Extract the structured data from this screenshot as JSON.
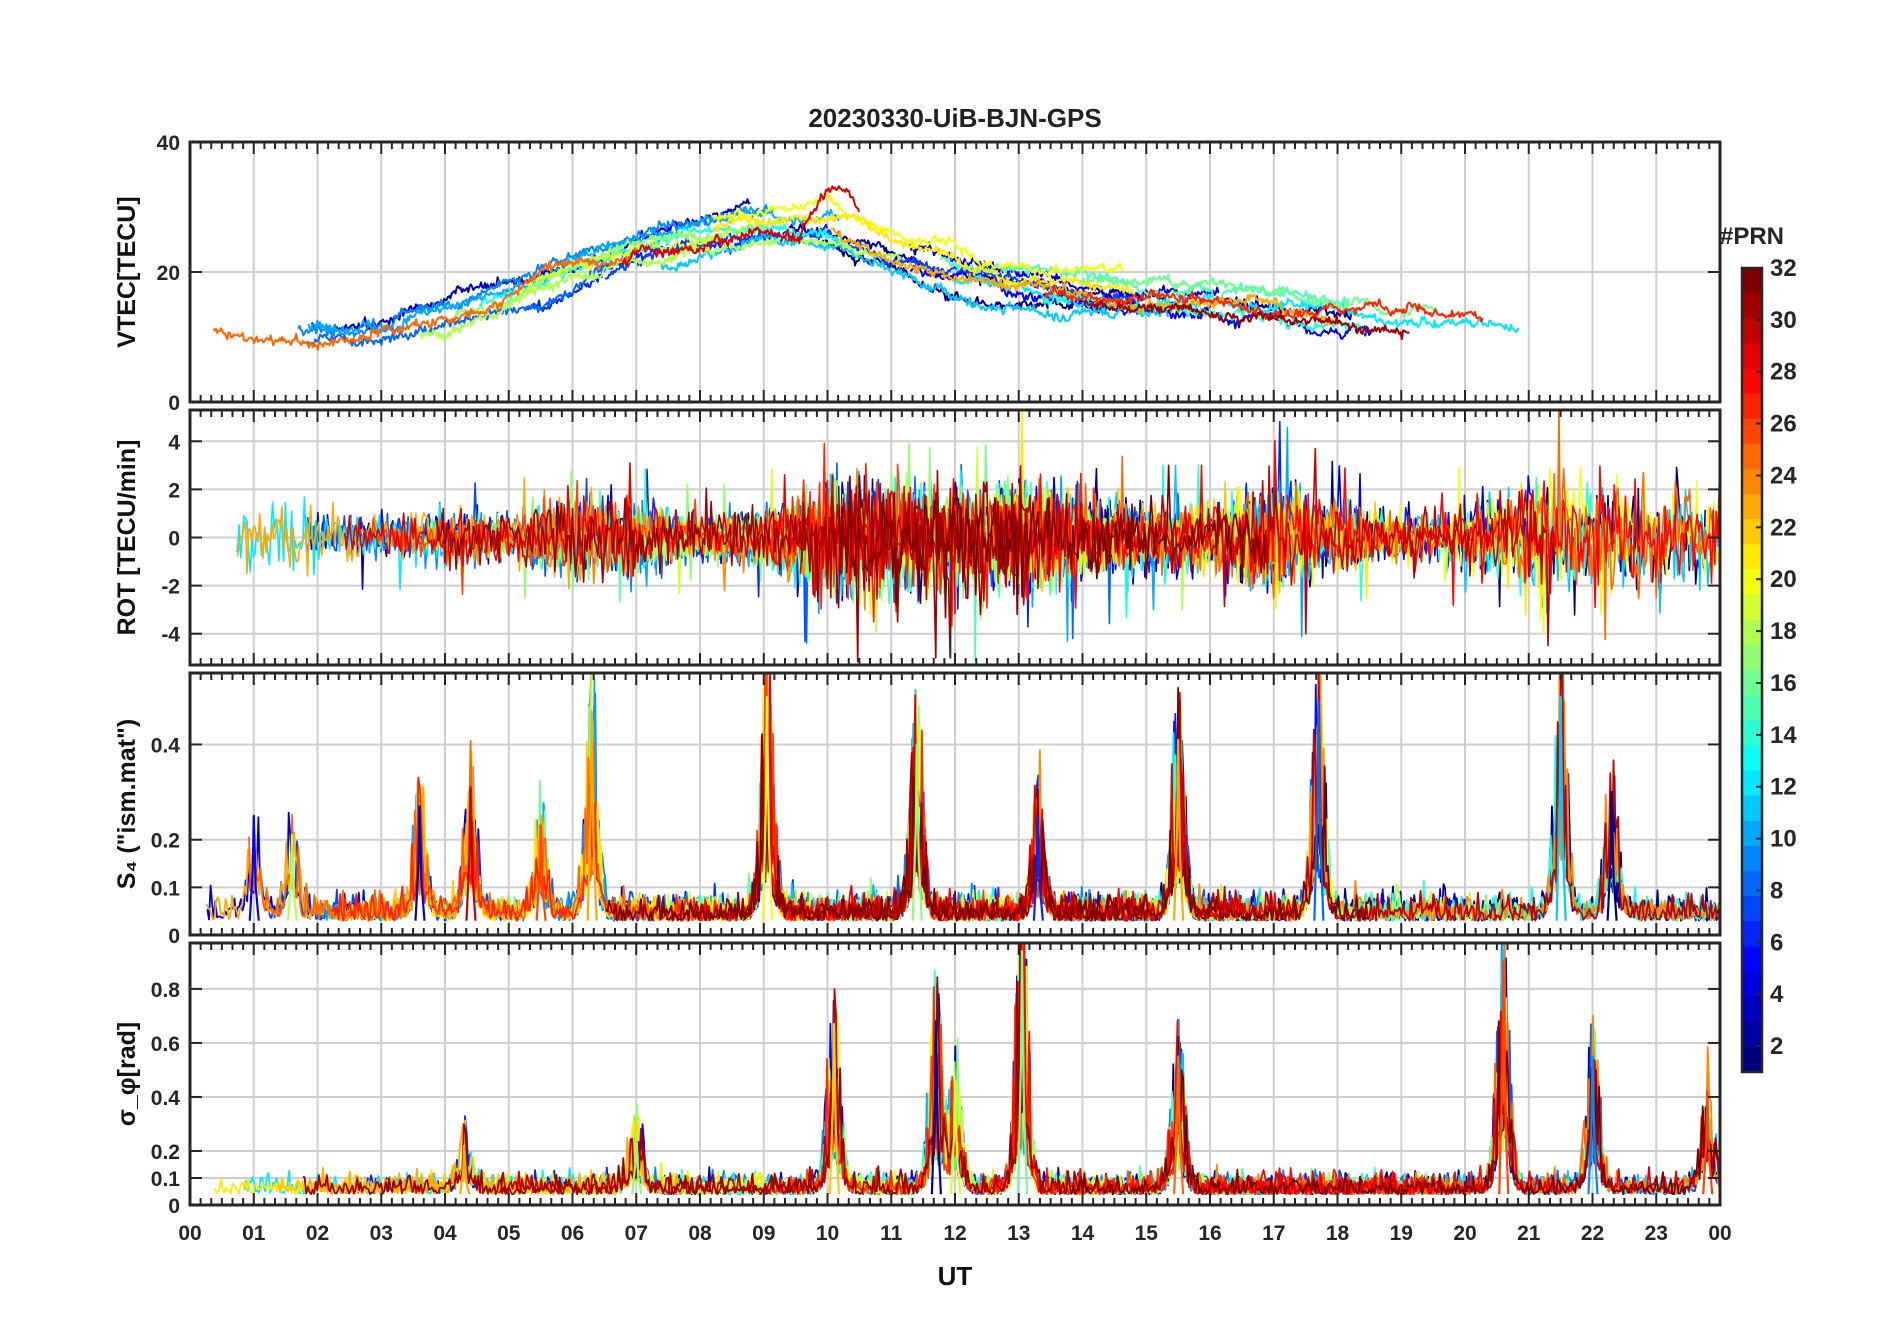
{
  "chart_data": {
    "type": "line",
    "title": "20230330-UiB-BJN-GPS",
    "xlabel": "UT",
    "x_ticks": [
      "00",
      "01",
      "02",
      "03",
      "04",
      "05",
      "06",
      "07",
      "08",
      "09",
      "10",
      "11",
      "12",
      "13",
      "14",
      "15",
      "16",
      "17",
      "18",
      "19",
      "20",
      "21",
      "22",
      "23",
      "00"
    ],
    "xlim": [
      0,
      24
    ],
    "colorbar": {
      "title": "#PRN",
      "range": [
        1,
        32
      ],
      "ticks": [
        "2",
        "4",
        "6",
        "8",
        "10",
        "12",
        "14",
        "16",
        "18",
        "20",
        "22",
        "24",
        "26",
        "28",
        "30",
        "32"
      ],
      "colormap": "jet",
      "color_low": "#00008f",
      "color_high": "#800000"
    },
    "panels": [
      {
        "ylabel": "VTEC[TECU]",
        "ylim": [
          0,
          40
        ],
        "y_ticks": [
          "0",
          "20",
          "40"
        ],
        "approx_trend": {
          "x_hours": [
            0,
            1,
            2,
            3,
            4,
            5,
            6,
            7,
            8,
            9,
            10,
            11,
            12,
            13,
            14,
            15,
            16,
            17,
            18,
            19,
            20,
            21,
            22,
            23,
            24
          ],
          "vtec_mean": [
            10,
            10,
            9,
            9,
            12,
            15,
            19,
            23,
            25,
            27,
            27,
            23,
            20,
            18,
            17,
            16,
            16,
            15,
            14,
            13,
            13,
            14,
            14,
            12,
            11
          ],
          "peak_value": 36,
          "peak_hour": 10.2
        }
      },
      {
        "ylabel": "ROT [TECU/min]",
        "ylim": [
          -5.3,
          5.3
        ],
        "y_ticks": [
          "-4",
          "-2",
          "0",
          "2",
          "4"
        ],
        "approx_envelope": {
          "x_hours": [
            0,
            1,
            2,
            3,
            4,
            5,
            6,
            7,
            8,
            9,
            10,
            11,
            12,
            13,
            14,
            15,
            16,
            17,
            18,
            19,
            20,
            21,
            22,
            23,
            24
          ],
          "abs_peak": [
            2.5,
            3,
            2.5,
            2,
            2.5,
            2,
            4,
            3,
            2,
            2.5,
            5.3,
            5,
            5,
            5.3,
            4,
            3,
            3,
            5,
            3,
            2,
            3,
            5.3,
            5.3,
            5,
            4
          ]
        }
      },
      {
        "ylabel": "S₄ (\"ism.mat\")",
        "ylim": [
          0,
          0.55
        ],
        "y_ticks": [
          "0",
          "0.1",
          "0.2",
          "0.4"
        ],
        "approx_peaks": [
          {
            "hour": 1.0,
            "value": 0.25
          },
          {
            "hour": 1.6,
            "value": 0.21
          },
          {
            "hour": 3.6,
            "value": 0.27
          },
          {
            "hour": 4.4,
            "value": 0.31
          },
          {
            "hour": 5.5,
            "value": 0.23
          },
          {
            "hour": 6.3,
            "value": 0.47
          },
          {
            "hour": 9.05,
            "value": 0.5
          },
          {
            "hour": 11.4,
            "value": 0.4
          },
          {
            "hour": 13.3,
            "value": 0.25
          },
          {
            "hour": 15.5,
            "value": 0.41
          },
          {
            "hour": 17.7,
            "value": 0.49
          },
          {
            "hour": 21.5,
            "value": 0.5
          },
          {
            "hour": 22.3,
            "value": 0.3
          }
        ]
      },
      {
        "ylabel": "σ_φ[rad]",
        "ylim": [
          0,
          0.97
        ],
        "y_ticks": [
          "0",
          "0.1",
          "0.2",
          "0.4",
          "0.6",
          "0.8"
        ],
        "approx_peaks": [
          {
            "hour": 4.3,
            "value": 0.22
          },
          {
            "hour": 7.0,
            "value": 0.27
          },
          {
            "hour": 10.1,
            "value": 0.67
          },
          {
            "hour": 11.7,
            "value": 0.68
          },
          {
            "hour": 12.0,
            "value": 0.45
          },
          {
            "hour": 13.05,
            "value": 0.94
          },
          {
            "hour": 15.5,
            "value": 0.55
          },
          {
            "hour": 20.6,
            "value": 0.9
          },
          {
            "hour": 22.0,
            "value": 0.55
          },
          {
            "hour": 23.8,
            "value": 0.42
          }
        ]
      }
    ]
  }
}
